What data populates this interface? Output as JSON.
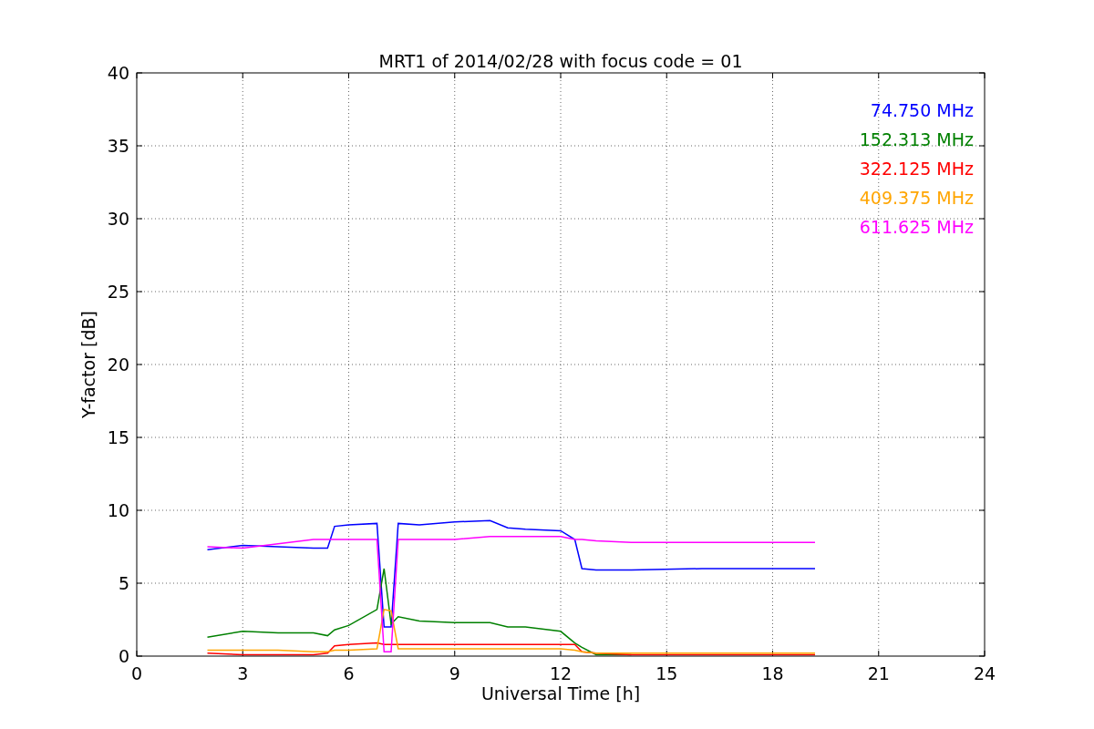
{
  "chart_data": {
    "type": "line",
    "title": "MRT1 of 2014/02/28 with focus code = 01",
    "xlabel": "Universal Time [h]",
    "ylabel": "Y-factor [dB]",
    "x": [
      2,
      3,
      4,
      5,
      5.4,
      5.6,
      6,
      6.8,
      7.0,
      7.2,
      7.4,
      8,
      9,
      10,
      10.5,
      11,
      12,
      12.4,
      12.6,
      13,
      14,
      16,
      18,
      19.2
    ],
    "series": [
      {
        "name": "74.750 MHz",
        "color": "#0000ff",
        "values": [
          7.3,
          7.6,
          7.5,
          7.4,
          7.4,
          8.9,
          9.0,
          9.1,
          2.0,
          2.0,
          9.1,
          9.0,
          9.2,
          9.3,
          8.8,
          8.7,
          8.6,
          8.0,
          6.0,
          5.9,
          5.9,
          6.0,
          6.0,
          6.0
        ]
      },
      {
        "name": "152.313 MHz",
        "color": "#008000",
        "values": [
          1.3,
          1.7,
          1.6,
          1.6,
          1.4,
          1.8,
          2.1,
          3.2,
          6.0,
          2.2,
          2.7,
          2.4,
          2.3,
          2.3,
          2.0,
          2.0,
          1.7,
          0.9,
          0.6,
          0.1,
          0.1,
          null,
          null,
          null
        ]
      },
      {
        "name": "322.125 MHz",
        "color": "#ff0000",
        "values": [
          0.2,
          0.1,
          0.1,
          0.1,
          0.2,
          0.7,
          0.8,
          0.9,
          0.8,
          0.8,
          0.8,
          0.8,
          0.8,
          0.8,
          0.8,
          0.8,
          0.8,
          0.8,
          0.3,
          0.2,
          0.1,
          0.1,
          0.1,
          0.1
        ]
      },
      {
        "name": "409.375 MHz",
        "color": "#ffa500",
        "values": [
          0.4,
          0.4,
          0.4,
          0.3,
          0.3,
          0.4,
          0.4,
          0.5,
          3.2,
          3.1,
          0.5,
          0.5,
          0.5,
          0.5,
          0.5,
          0.5,
          0.5,
          0.4,
          0.3,
          0.2,
          0.2,
          0.2,
          0.2,
          0.2
        ]
      },
      {
        "name": "611.625 MHz",
        "color": "#ff00ff",
        "values": [
          7.5,
          7.4,
          7.7,
          8.0,
          8.0,
          8.0,
          8.0,
          8.0,
          0.3,
          0.3,
          8.0,
          8.0,
          8.0,
          8.2,
          8.2,
          8.2,
          8.2,
          8.0,
          8.0,
          7.9,
          7.8,
          7.8,
          7.8,
          7.8
        ]
      }
    ],
    "xlim": [
      0,
      24
    ],
    "ylim": [
      0,
      40
    ],
    "xticks": [
      0,
      3,
      6,
      9,
      12,
      15,
      18,
      21,
      24
    ],
    "yticks": [
      0,
      5,
      10,
      15,
      20,
      25,
      30,
      35,
      40
    ],
    "grid": true
  }
}
